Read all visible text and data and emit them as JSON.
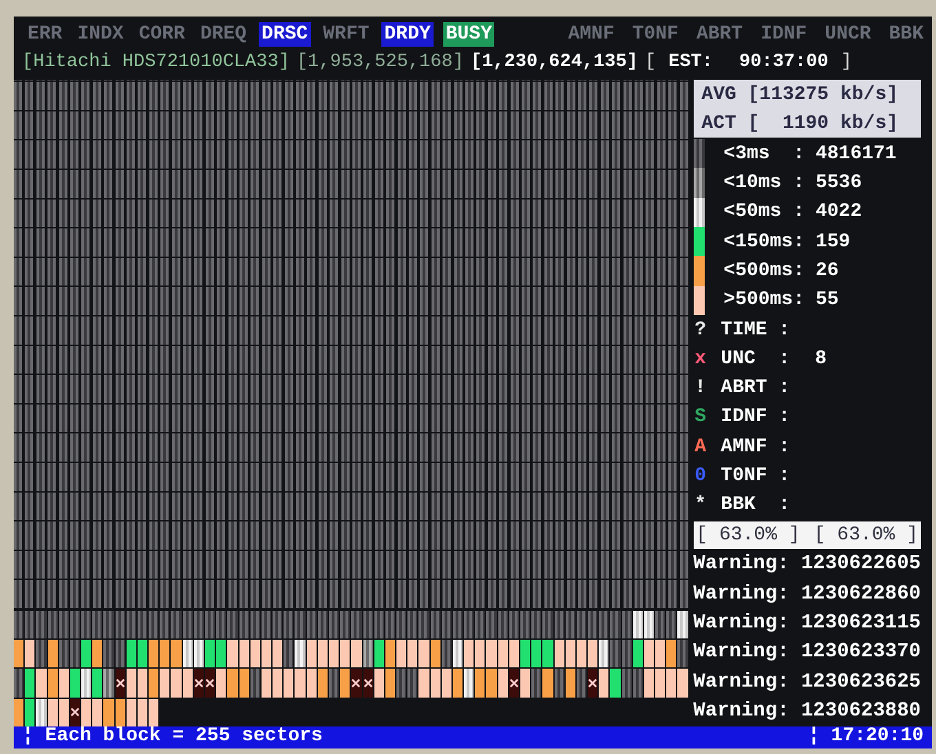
{
  "status_flags": [
    {
      "label": "ERR",
      "on": false
    },
    {
      "label": "INDX",
      "on": false
    },
    {
      "label": "CORR",
      "on": false
    },
    {
      "label": "DREQ",
      "on": false
    },
    {
      "label": "DRSC",
      "on": true,
      "color": "#1a1ad0"
    },
    {
      "label": "WRFT",
      "on": false
    },
    {
      "label": "DRDY",
      "on": true,
      "color": "#1a1ad0"
    },
    {
      "label": "BUSY",
      "on": true,
      "color": "#1e9a5a"
    }
  ],
  "error_flags": [
    {
      "label": "AMNF",
      "on": false
    },
    {
      "label": "T0NF",
      "on": false
    },
    {
      "label": "ABRT",
      "on": false
    },
    {
      "label": "IDNF",
      "on": false
    },
    {
      "label": "UNCR",
      "on": false
    },
    {
      "label": "BBK",
      "on": false
    }
  ],
  "header": {
    "model": "[Hitachi HDS721010CLA33]",
    "capacity": "[1,953,525,168]",
    "position": "[1,230,624,135]",
    "est_open": "[",
    "est_label": "EST:",
    "est_value": "90:37:00",
    "est_close": "]"
  },
  "block_map": {
    "rows": [
      [
        {
          "kind": "a"
        },
        {
          "kind": "a"
        },
        {
          "kind": "a"
        },
        {
          "kind": "a"
        },
        {
          "kind": "a"
        },
        {
          "kind": "a"
        },
        {
          "kind": "a"
        },
        {
          "kind": "a"
        },
        {
          "kind": "a"
        },
        {
          "kind": "a"
        },
        {
          "kind": "a"
        },
        {
          "kind": "a"
        },
        {
          "kind": "a"
        },
        {
          "kind": "a"
        },
        {
          "kind": "a"
        },
        {
          "kind": "a"
        },
        {
          "kind": "a"
        },
        {
          "kind": "a"
        },
        {
          "kind": "a"
        },
        {
          "kind": "a"
        },
        {
          "kind": "a"
        },
        {
          "kind": "a"
        },
        {
          "kind": "a"
        },
        {
          "kind": "a"
        },
        {
          "kind": "a"
        },
        {
          "kind": "a"
        },
        {
          "kind": "a"
        },
        {
          "kind": "a"
        },
        {
          "kind": "a"
        },
        {
          "kind": "a"
        },
        {
          "kind": "a"
        },
        {
          "kind": "a"
        },
        {
          "kind": "a"
        },
        {
          "kind": "a"
        },
        {
          "kind": "a"
        },
        {
          "kind": "a"
        },
        {
          "kind": "a"
        },
        {
          "kind": "a"
        },
        {
          "kind": "a"
        },
        {
          "kind": "a"
        },
        {
          "kind": "a"
        },
        {
          "kind": "a"
        },
        {
          "kind": "a"
        },
        {
          "kind": "a"
        },
        {
          "kind": "a"
        },
        {
          "kind": "a"
        },
        {
          "kind": "a"
        },
        {
          "kind": "a"
        },
        {
          "kind": "a"
        },
        {
          "kind": "a"
        },
        {
          "kind": "a"
        },
        {
          "kind": "a"
        },
        {
          "kind": "a"
        },
        {
          "kind": "a"
        },
        {
          "kind": "a"
        },
        {
          "kind": "c"
        },
        {
          "kind": "c"
        },
        {
          "kind": "a"
        },
        {
          "kind": "a"
        },
        {
          "kind": "c"
        }
      ],
      [
        {
          "kind": "e"
        },
        {
          "kind": "f"
        },
        {
          "kind": "a"
        },
        {
          "kind": "e"
        },
        {
          "kind": "a"
        },
        {
          "kind": "a"
        },
        {
          "kind": "d"
        },
        {
          "kind": "e"
        },
        {
          "kind": "a"
        },
        {
          "kind": "a"
        },
        {
          "kind": "d"
        },
        {
          "kind": "d"
        },
        {
          "kind": "e"
        },
        {
          "kind": "e"
        },
        {
          "kind": "e"
        },
        {
          "kind": "c"
        },
        {
          "kind": "c"
        },
        {
          "kind": "d"
        },
        {
          "kind": "d"
        },
        {
          "kind": "f"
        },
        {
          "kind": "f"
        },
        {
          "kind": "f"
        },
        {
          "kind": "f"
        },
        {
          "kind": "f"
        },
        {
          "kind": "a"
        },
        {
          "kind": "c"
        },
        {
          "kind": "f"
        },
        {
          "kind": "f"
        },
        {
          "kind": "f"
        },
        {
          "kind": "f"
        },
        {
          "kind": "f"
        },
        {
          "kind": "b"
        },
        {
          "kind": "d"
        },
        {
          "kind": "e"
        },
        {
          "kind": "f"
        },
        {
          "kind": "f"
        },
        {
          "kind": "f"
        },
        {
          "kind": "e"
        },
        {
          "kind": "a"
        },
        {
          "kind": "c"
        },
        {
          "kind": "f"
        },
        {
          "kind": "f"
        },
        {
          "kind": "f"
        },
        {
          "kind": "f"
        },
        {
          "kind": "f"
        },
        {
          "kind": "d"
        },
        {
          "kind": "d"
        },
        {
          "kind": "d"
        },
        {
          "kind": "f"
        },
        {
          "kind": "f"
        },
        {
          "kind": "f"
        },
        {
          "kind": "f"
        },
        {
          "kind": "c"
        },
        {
          "kind": "a"
        },
        {
          "kind": "a"
        },
        {
          "kind": "d"
        },
        {
          "kind": "f"
        },
        {
          "kind": "f"
        },
        {
          "kind": "e"
        },
        {
          "kind": "a"
        }
      ],
      [
        {
          "kind": "a"
        },
        {
          "kind": "d"
        },
        {
          "kind": "f"
        },
        {
          "kind": "e"
        },
        {
          "kind": "f"
        },
        {
          "kind": "d"
        },
        {
          "kind": "c"
        },
        {
          "kind": "d"
        },
        {
          "kind": "b"
        },
        {
          "kind": "x"
        },
        {
          "kind": "f"
        },
        {
          "kind": "f"
        },
        {
          "kind": "e"
        },
        {
          "kind": "f"
        },
        {
          "kind": "f"
        },
        {
          "kind": "f"
        },
        {
          "kind": "x"
        },
        {
          "kind": "x"
        },
        {
          "kind": "f"
        },
        {
          "kind": "e"
        },
        {
          "kind": "e"
        },
        {
          "kind": "a"
        },
        {
          "kind": "f"
        },
        {
          "kind": "f"
        },
        {
          "kind": "f"
        },
        {
          "kind": "f"
        },
        {
          "kind": "f"
        },
        {
          "kind": "e"
        },
        {
          "kind": "a"
        },
        {
          "kind": "e"
        },
        {
          "kind": "x"
        },
        {
          "kind": "x"
        },
        {
          "kind": "f"
        },
        {
          "kind": "e"
        },
        {
          "kind": "a"
        },
        {
          "kind": "a"
        },
        {
          "kind": "f"
        },
        {
          "kind": "f"
        },
        {
          "kind": "f"
        },
        {
          "kind": "e"
        },
        {
          "kind": "c"
        },
        {
          "kind": "e"
        },
        {
          "kind": "e"
        },
        {
          "kind": "f"
        },
        {
          "kind": "x"
        },
        {
          "kind": "f"
        },
        {
          "kind": "a"
        },
        {
          "kind": "e"
        },
        {
          "kind": "a"
        },
        {
          "kind": "e"
        },
        {
          "kind": "a"
        },
        {
          "kind": "x"
        },
        {
          "kind": "f"
        },
        {
          "kind": "d"
        },
        {
          "kind": "a"
        },
        {
          "kind": "a"
        },
        {
          "kind": "f"
        },
        {
          "kind": "f"
        },
        {
          "kind": "f"
        },
        {
          "kind": "f"
        }
      ],
      [
        {
          "kind": "e"
        },
        {
          "kind": "d"
        },
        {
          "kind": "c"
        },
        {
          "kind": "f"
        },
        {
          "kind": "f"
        },
        {
          "kind": "x"
        },
        {
          "kind": "f"
        },
        {
          "kind": "f"
        },
        {
          "kind": "e"
        },
        {
          "kind": "e"
        },
        {
          "kind": "f"
        },
        {
          "kind": "f"
        },
        {
          "kind": "f"
        }
      ]
    ]
  },
  "speed": {
    "avg": "AVG [113275 kb/s]",
    "act": "ACT [  1190 kb/s]"
  },
  "latency_legend": [
    {
      "kind": "a",
      "label": "<3ms  :",
      "count": "4816171"
    },
    {
      "kind": "b",
      "label": "<10ms :",
      "count": "5536"
    },
    {
      "kind": "c",
      "label": "<50ms :",
      "count": "4022"
    },
    {
      "kind": "d",
      "label": "<150ms:",
      "count": "159"
    },
    {
      "kind": "e",
      "label": "<500ms:",
      "count": "26"
    },
    {
      "kind": "f",
      "label": ">500ms:",
      "count": "55"
    }
  ],
  "error_legend": [
    {
      "symbol": "?",
      "color": "#e8e8e8",
      "label": "TIME :"
    },
    {
      "symbol": "x",
      "color": "#ff5a78",
      "label": "UNC  :",
      "count": "8"
    },
    {
      "symbol": "!",
      "color": "#e8e8e8",
      "label": "ABRT :"
    },
    {
      "symbol": "S",
      "color": "#2fa862",
      "label": "IDNF :"
    },
    {
      "symbol": "A",
      "color": "#ff6a55",
      "label": "AMNF :"
    },
    {
      "symbol": "0",
      "color": "#3a5cff",
      "label": "T0NF :"
    },
    {
      "symbol": "*",
      "color": "#e8e8e8",
      "label": "BBK  :"
    }
  ],
  "progress": [
    "[ 63.0% ]",
    "[ 63.0% ]"
  ],
  "warnings": [
    "Warning: 1230622605",
    "Warning: 1230622860",
    "Warning: 1230623115",
    "Warning: 1230623370",
    "Warning: 1230623625",
    "Warning: 1230623880"
  ],
  "status_bar": {
    "left": "¦ Each block = 255 sectors",
    "right": "¦ 17:20:10"
  }
}
